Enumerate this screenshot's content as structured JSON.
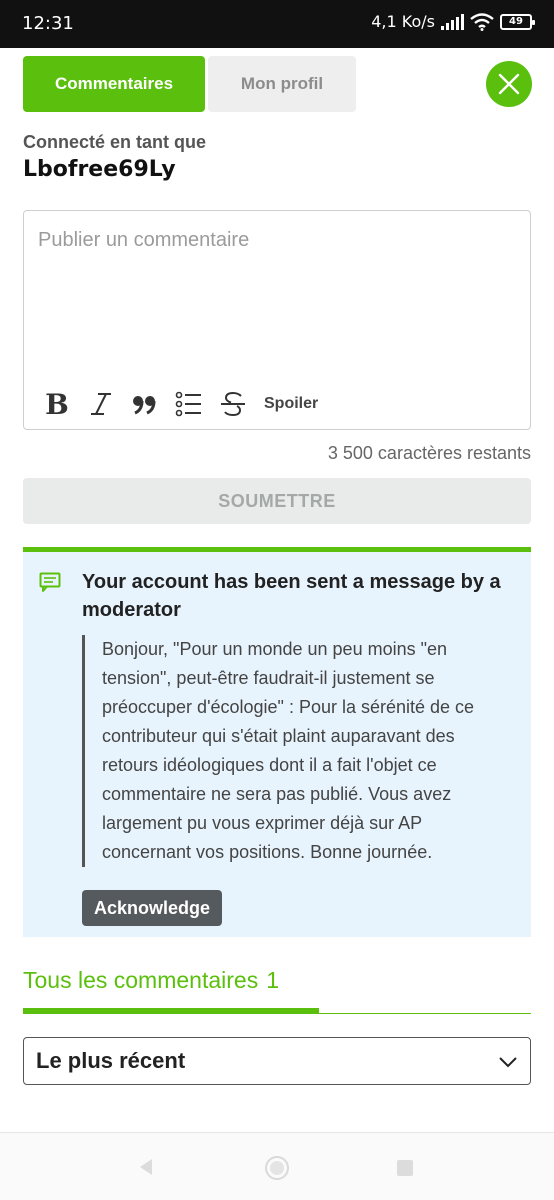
{
  "status_bar": {
    "time": "12:31",
    "speed": "4,1 Ko/s",
    "battery": "49"
  },
  "tabs": {
    "comments": "Commentaires",
    "profile": "Mon profil"
  },
  "user": {
    "connected_label": "Connecté en tant que",
    "username": "Lbofree69Ly"
  },
  "editor": {
    "placeholder": "Publier un commentaire",
    "value": "",
    "toolbar": {
      "bold_glyph": "B",
      "italic_glyph": "I",
      "spoiler_label": "Spoiler"
    },
    "chars_remaining": "3 500 caractères restants",
    "submit_label": "SOUMETTRE"
  },
  "moderator_message": {
    "title": "Your account has been sent a message by a moderator",
    "body": "Bonjour, \"Pour un monde un peu moins \"en tension\", peut-être faudrait-il justement se préoccuper d'écologie\" : Pour la sérénité de ce contributeur qui s'était plaint auparavant des retours idéologiques dont il a fait l'objet ce commentaire ne sera pas publié. Vous avez largement pu vous exprimer déjà sur AP concernant vos positions. Bonne journée.",
    "acknowledge_label": "Acknowledge"
  },
  "comments_section": {
    "title": "Tous les commentaires",
    "count": "1",
    "sort_selected": "Le plus récent"
  },
  "colors": {
    "accent": "#5bbf0d",
    "message_bg": "#e8f4fd",
    "button_dark": "#555a5e"
  },
  "icons": {
    "close": "close-icon",
    "message": "message-icon",
    "bold": "bold-icon",
    "italic": "italic-icon",
    "quote": "quote-icon",
    "list": "list-icon",
    "strikethrough": "strikethrough-icon",
    "dropdown": "chevron-down-icon"
  }
}
